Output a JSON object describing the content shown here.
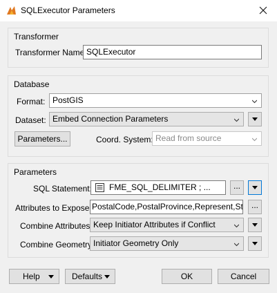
{
  "window": {
    "title": "SQLExecutor Parameters",
    "close_icon": "close-icon",
    "app_icon": "fme-app-icon"
  },
  "transformer": {
    "group_label": "Transformer",
    "name_label": "Transformer Name:",
    "name_value": "SQLExecutor"
  },
  "database": {
    "group_label": "Database",
    "format_label": "Format:",
    "format_value": "PostGIS",
    "dataset_label": "Dataset:",
    "dataset_value": "Embed Connection Parameters",
    "parameters_button": "Parameters...",
    "coord_label": "Coord. System:",
    "coord_value": "Read from source"
  },
  "parameters": {
    "group_label": "Parameters",
    "sql_label": "SQL Statement:",
    "sql_value": "FME_SQL_DELIMITER ; ...",
    "attrs_label": "Attributes to Expose:",
    "attrs_value": "PostalCode,PostalProvince,Represent,Status",
    "combine_attr_label": "Combine Attributes:",
    "combine_attr_value": "Keep Initiator Attributes if Conflict",
    "combine_geom_label": "Combine Geometry:",
    "combine_geom_value": "Initiator Geometry Only",
    "ellipsis": "..."
  },
  "footer": {
    "help": "Help",
    "defaults": "Defaults",
    "ok": "OK",
    "cancel": "Cancel"
  },
  "colors": {
    "focus_blue": "#0078d7",
    "window_bg": "#f0f0f0"
  }
}
